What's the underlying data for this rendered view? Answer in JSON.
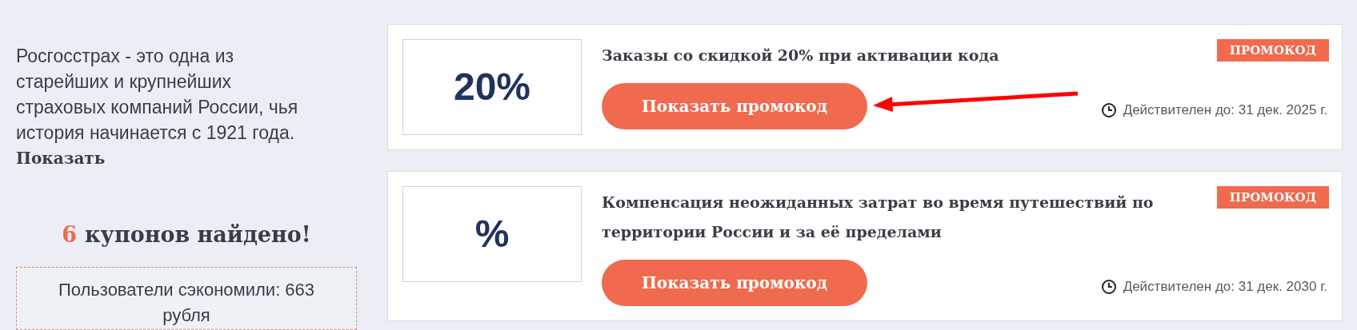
{
  "about": {
    "text": "Росгосстрах - это одна из старейших и крупнейших страховых компаний России, чья история начинается с 1921 года.",
    "more_link": "Показать"
  },
  "found": {
    "count": "6",
    "text": "купонов найдено!"
  },
  "savings": "Пользователи сэкономили: 663 рубля",
  "coupons": [
    {
      "value": "20%",
      "title": "Заказы со скидкой 20% при активации кода",
      "button": "Показать промокод",
      "badge": "ПРОМОКОД",
      "expires": "Действителен до: 31 дек. 2025 г.",
      "annotated": true
    },
    {
      "value": "%",
      "title": "Компенсация неожиданных затрат во время путешествий по территории России и за её пределами",
      "button": "Показать промокод",
      "badge": "ПРОМОКОД",
      "expires": "Действителен до: 31 дек. 2030 г.",
      "annotated": false
    }
  ]
}
